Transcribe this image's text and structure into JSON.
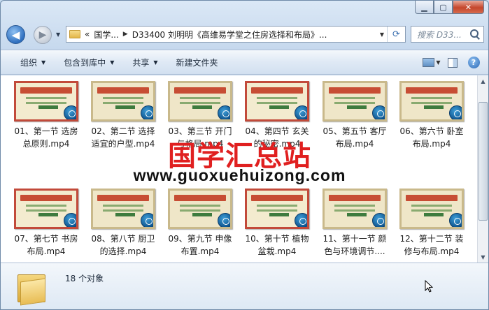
{
  "address": {
    "root": "国学...",
    "path": "D33400 刘明明《高维易学堂之住房选择和布局》..."
  },
  "search": {
    "placeholder": "搜索 D33..."
  },
  "toolbar": {
    "organize": "组织",
    "include_library": "包含到库中",
    "share": "共享",
    "new_folder": "新建文件夹"
  },
  "files": [
    {
      "label": "01、第一节 选房总原则.mp4"
    },
    {
      "label": "02、第二节 选择适宜的户型.mp4"
    },
    {
      "label": "03、第三节 开门与格局.mp4"
    },
    {
      "label": "04、第四节 玄关的秘密.mp4"
    },
    {
      "label": "05、第五节 客厅布局.mp4"
    },
    {
      "label": "06、第六节 卧室布局.mp4"
    },
    {
      "label": "07、第七节 书房布局.mp4"
    },
    {
      "label": "08、第八节 厨卫的选择.mp4"
    },
    {
      "label": "09、第九节 申像布置.mp4"
    },
    {
      "label": "10、第十节 植物盆栽.mp4"
    },
    {
      "label": "11、第十一节 颜色与环境调节...."
    },
    {
      "label": "12、第十二节 装修与布局.mp4"
    }
  ],
  "watermark": {
    "title": "国学汇总站",
    "url": "www.guoxuehuizong.com"
  },
  "details": {
    "count": "18 个对象"
  },
  "icons": {
    "back": "back-arrow-icon",
    "forward": "forward-arrow-icon",
    "media": "media-player-icon",
    "folder": "folder-icon"
  }
}
